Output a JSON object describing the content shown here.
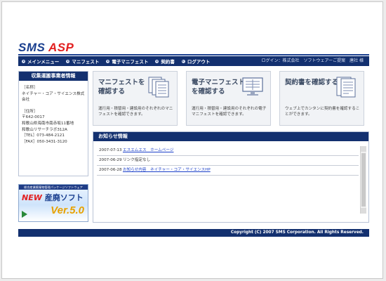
{
  "logo": {
    "sms": "SMS",
    "asp": "ASP"
  },
  "nav": {
    "items": [
      "メインメニュー",
      "マニフェスト",
      "電子マニフェスト",
      "契約書",
      "ログアウト"
    ],
    "login": "ログイン：株式会社　ソフトウェアーご提案　唐社 様"
  },
  "sidebar": {
    "header": "収集運搬事業者情報",
    "name_label": "［名称］",
    "name_value_1": "ネイチャー・コア・サイエンス株式",
    "name_value_2": "会社",
    "address_label": "［住所］",
    "postal": "〒642-0017",
    "address_1": "和歌山県海南市南赤坂11番地",
    "address_2": "和歌山リサーチラボ312A",
    "tel": "［TEL］073-484-2121",
    "fax": "［FAX］050-3431-3120"
  },
  "banner": {
    "top": "総合産業廃棄物管理パッケージソフトウェア",
    "new": "NEW",
    "product": "産廃ソフト",
    "version": "Ver.5.0"
  },
  "cards": [
    {
      "title_1": "マニフェストを",
      "title_2": "確認する",
      "desc_1": "運行用・積替用・建設用のそれぞれのマニ",
      "desc_2": "フェストを確認できます。",
      "icon": "document-stack-icon"
    },
    {
      "title_1": "電子マニフェスト",
      "title_2": "を確認する",
      "desc_1": "運行用・積替用・建設用のそれぞれの電子",
      "desc_2": "マニフェストを確認できます。",
      "icon": "monitor-icon"
    },
    {
      "title_1": "契約書を確認する",
      "title_2": "",
      "desc_1": "ウェブ上でカンタンに契約書を確認するこ",
      "desc_2": "とができます。",
      "icon": "contract-document-icon"
    }
  ],
  "notice": {
    "header": "お知らせ情報",
    "items": [
      {
        "date": "2007-07-13",
        "text": "エスエムエス　ホームページ",
        "link": true
      },
      {
        "date": "2007-06-29",
        "text": "リンク指定なし",
        "link": false
      },
      {
        "date": "2007-06-28",
        "text": "お知らせ内容　ネイチャー・コア・サイエンスHP",
        "link": true
      }
    ]
  },
  "footer": {
    "copyright": "Copyright (C) 2007 SMS Corporation. All Rights Reserved."
  },
  "colors": {
    "navy": "#13306f",
    "accent_red": "#e21f1f",
    "link_blue": "#1a3fc9"
  }
}
